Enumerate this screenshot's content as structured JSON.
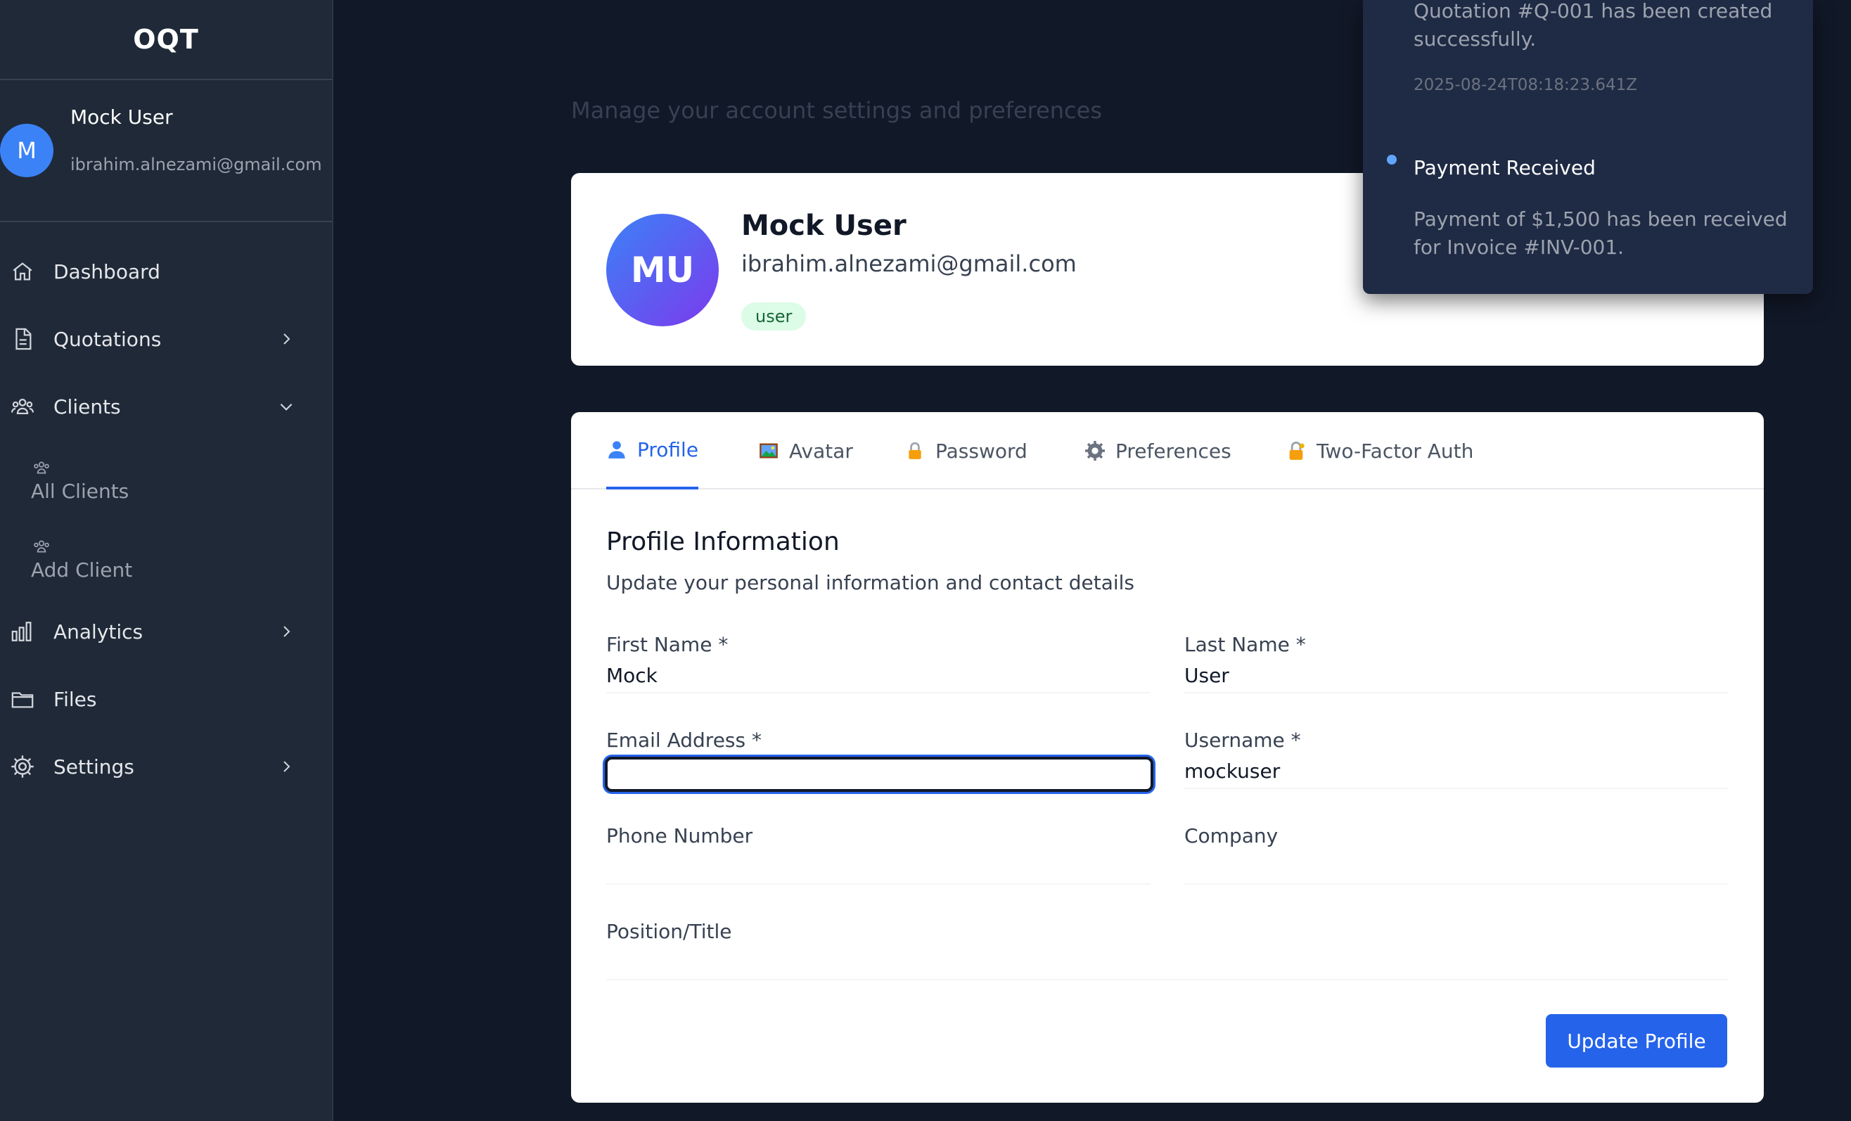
{
  "app": {
    "brand": "OQT"
  },
  "user": {
    "initial": "M",
    "name": "Mock User",
    "email": "ibrahim.alnezami@gmail.com"
  },
  "nav": {
    "dashboard": "Dashboard",
    "quotations": "Quotations",
    "clients": "Clients",
    "all_clients": "All Clients",
    "add_client": "Add Client",
    "analytics": "Analytics",
    "files": "Files",
    "settings": "Settings"
  },
  "page": {
    "subtitle": "Manage your account settings and preferences"
  },
  "profile_card": {
    "initials": "MU",
    "name": "Mock User",
    "email": "ibrahim.alnezami@gmail.com",
    "role": "user"
  },
  "tabs": [
    {
      "label": "Profile",
      "icon": "user-icon",
      "active": true
    },
    {
      "label": "Avatar",
      "icon": "image-icon",
      "active": false
    },
    {
      "label": "Password",
      "icon": "lock-icon",
      "active": false
    },
    {
      "label": "Preferences",
      "icon": "gear-icon",
      "active": false
    },
    {
      "label": "Two-Factor Auth",
      "icon": "lock-key-icon",
      "active": false
    }
  ],
  "form": {
    "title": "Profile Information",
    "description": "Update your personal information and contact details",
    "first_name_label": "First Name *",
    "first_name_value": "Mock",
    "last_name_label": "Last Name *",
    "last_name_value": "User",
    "email_label": "Email Address *",
    "email_value": "",
    "username_label": "Username *",
    "username_value": "mockuser",
    "phone_label": "Phone Number",
    "phone_value": "",
    "company_label": "Company",
    "company_value": "",
    "position_label": "Position/Title",
    "position_value": "",
    "submit_label": "Update Profile"
  },
  "notifications": {
    "items": [
      {
        "message": "Quotation #Q-001 has been created successfully.",
        "time": "2025-08-24T08:18:23.641Z"
      },
      {
        "title": "Payment Received",
        "message": "Payment of $1,500 has been received for Invoice #INV-001.",
        "unread": true
      }
    ]
  },
  "colors": {
    "accent": "#2563eb",
    "sidebar_bg": "#1f2937",
    "page_bg": "#111827",
    "notification_bg": "#1f2a44"
  }
}
